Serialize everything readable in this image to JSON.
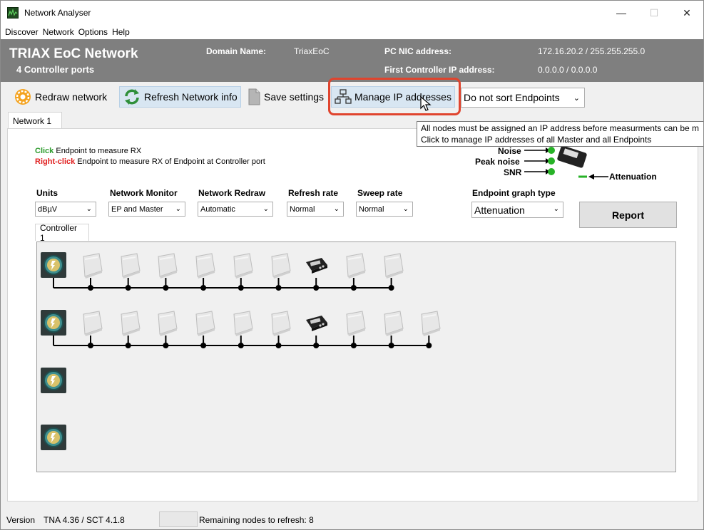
{
  "window": {
    "title": "Network Analyser",
    "controls": {
      "minimize": "—",
      "maximize": "☐",
      "close": "✕"
    }
  },
  "menu": [
    "Discover",
    "Network",
    "Options",
    "Help"
  ],
  "header": {
    "title": "TRIAX EoC Network",
    "subtitle": "4 Controller ports",
    "domain_label": "Domain Name:",
    "domain_value": "TriaxEoC",
    "nic_label": "PC NIC address:",
    "nic_value": "172.16.20.2 / 255.255.255.0",
    "ctrl_ip_label": "First Controller IP address:",
    "ctrl_ip_value": "0.0.0.0 / 0.0.0.0"
  },
  "toolbar": {
    "redraw": "Redraw network",
    "refresh": "Refresh Network info",
    "save": "Save settings",
    "manage_ip": "Manage IP addresses",
    "sort_value": "Do not sort Endpoints"
  },
  "tooltip": {
    "line1": "All nodes must be assigned an IP address before measurments can be m",
    "line2": "Click to manage IP addresses of all Master and all Endpoints"
  },
  "tabs": {
    "network": "Network 1",
    "controller": "Controller 1"
  },
  "hints": {
    "click_word": "Click",
    "click_text": " Endpoint to measure RX",
    "right_word": "Right-click",
    "right_text": " Endpoint to measure RX of Endpoint at Controller port"
  },
  "legend": {
    "noise": "Noise",
    "peak_noise": "Peak noise",
    "snr": "SNR",
    "attenuation": "Attenuation"
  },
  "controls": {
    "units": {
      "label": "Units",
      "value": "dBµV"
    },
    "monitor": {
      "label": "Network Monitor",
      "value": "EP and Master"
    },
    "redraw": {
      "label": "Network Redraw",
      "value": "Automatic"
    },
    "refresh": {
      "label": "Refresh rate",
      "value": "Normal"
    },
    "sweep": {
      "label": "Sweep rate",
      "value": "Normal"
    },
    "graph": {
      "label": "Endpoint graph type",
      "value": "Attenuation"
    },
    "report": "Report"
  },
  "network": {
    "ports": [
      {
        "endpoints": 9,
        "master_index": 6
      },
      {
        "endpoints": 10,
        "master_index": 6
      },
      {
        "endpoints": 0,
        "master_index": -1
      },
      {
        "endpoints": 0,
        "master_index": -1
      }
    ]
  },
  "status": {
    "version_label": "Version",
    "version_value": "TNA 4.36 / SCT 4.1.8",
    "remaining": "Remaining nodes to refresh: 8"
  },
  "colors": {
    "header_bg": "#7f7f7f",
    "highlight": "#e0442e",
    "legend_green": "#27b227"
  }
}
